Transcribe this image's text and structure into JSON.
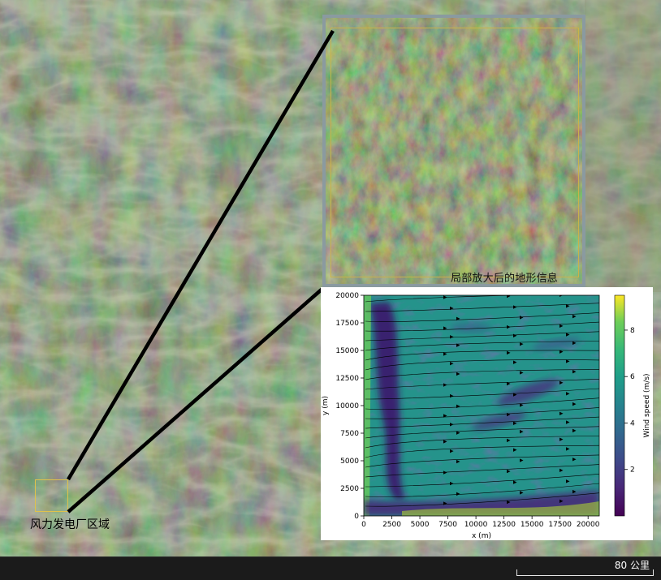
{
  "map": {
    "zoom_label": "局部放大后的地形信息",
    "site_label": "风力发电厂区域",
    "scale_label": "80 公里",
    "colors": {
      "terrain_base": "#3c4f38",
      "highlight_box": "#e0c24b",
      "connector": "#000000",
      "zoom_frame": "#8a9aa0"
    }
  },
  "chart_data": {
    "type": "heatmap",
    "title": "",
    "xlabel": "x (m)",
    "ylabel": "y (m)",
    "xlim": [
      0,
      21000
    ],
    "ylim": [
      0,
      20000
    ],
    "xticks": [
      0,
      2500,
      5000,
      7500,
      10000,
      12500,
      15000,
      17500,
      20000
    ],
    "yticks": [
      0,
      2500,
      5000,
      7500,
      10000,
      12500,
      15000,
      17500,
      20000
    ],
    "colorbar": {
      "label": "Wind speed (m/s)",
      "range": [
        0,
        9.5
      ],
      "ticks": [
        2,
        4,
        6,
        8
      ],
      "colormap": "viridis"
    },
    "overlay": "streamlines",
    "flow_direction": "west-to-east"
  }
}
